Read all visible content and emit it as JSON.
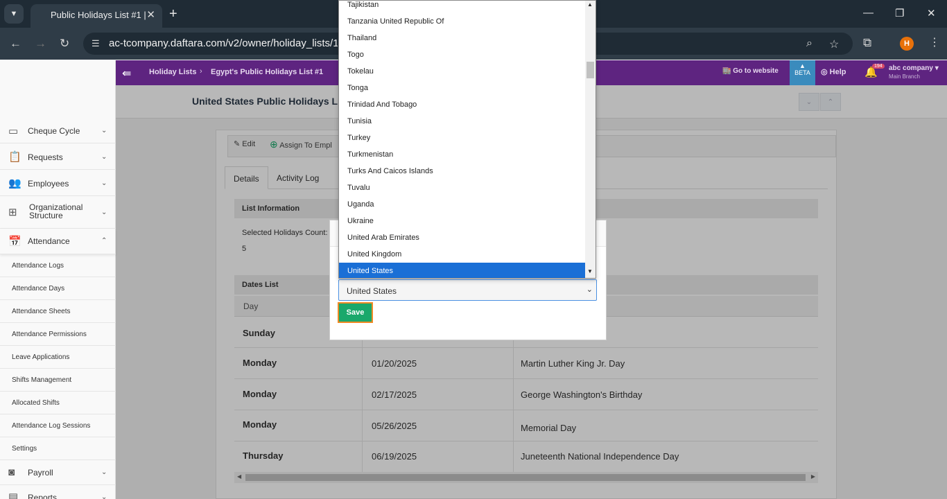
{
  "browser": {
    "tab_title": "Public Holidays List #1 |",
    "url": "ac-tcompany.daftara.com/v2/owner/holiday_lists/1?#"
  },
  "topbar": {
    "crumb1": "Holiday Lists",
    "crumb2": "Egypt's Public Holidays List #1",
    "go_website": "Go to website",
    "beta": "BETA",
    "help": "Help",
    "notif_count": "194",
    "company": "abc company",
    "branch": "Main Branch"
  },
  "sidebar": {
    "items": [
      {
        "label": "Cheque Cycle",
        "icon": "cheque-icon",
        "chevron": "chevron-down-icon"
      },
      {
        "label": "Requests",
        "icon": "clipboard-icon",
        "chevron": "chevron-down-icon"
      },
      {
        "label": "Employees",
        "icon": "users-icon",
        "chevron": "chevron-down-icon"
      },
      {
        "label": "Organizational Structure",
        "icon": "hierarchy-icon",
        "chevron": "chevron-down-icon"
      },
      {
        "label": "Attendance",
        "icon": "calendar-icon",
        "chevron": "chevron-up-icon"
      }
    ],
    "attendance_sub": [
      "Attendance Logs",
      "Attendance Days",
      "Attendance Sheets",
      "Attendance Permissions",
      "Leave Applications",
      "Shifts Management",
      "Allocated Shifts",
      "Attendance Log Sessions",
      "Settings"
    ],
    "payroll": {
      "label": "Payroll",
      "icon": "money-icon"
    },
    "reports": {
      "label": "Reports",
      "icon": "reports-icon"
    }
  },
  "page": {
    "title": "United States Public Holidays List",
    "actions": {
      "edit": "Edit",
      "assign": "Assign To Empl"
    },
    "tabs": [
      "Details",
      "Activity Log"
    ],
    "list_info": "List Information",
    "selected_count_label": "Selected Holidays Count:",
    "selected_count_value": "5",
    "dates_list": "Dates List",
    "col_day": "Day",
    "rows": [
      {
        "day": "Sunday",
        "date": "",
        "name": ""
      },
      {
        "day": "Monday",
        "date": "01/20/2025",
        "name": "Martin Luther King Jr. Day"
      },
      {
        "day": "Monday",
        "date": "02/17/2025",
        "name": "George Washington's Birthday"
      },
      {
        "day": "Monday",
        "date": "05/26/2025",
        "name": "Memorial Day"
      },
      {
        "day": "Thursday",
        "date": "06/19/2025",
        "name": "Juneteenth National Independence Day"
      }
    ]
  },
  "modal": {
    "selected_country": "United States",
    "save": "Save",
    "options": [
      "Tajikistan",
      "Tanzania United Republic Of",
      "Thailand",
      "Togo",
      "Tokelau",
      "Tonga",
      "Trinidad And Tobago",
      "Tunisia",
      "Turkey",
      "Turkmenistan",
      "Turks And Caicos Islands",
      "Tuvalu",
      "Uganda",
      "Ukraine",
      "United Arab Emirates",
      "United Kingdom",
      "United States"
    ]
  }
}
